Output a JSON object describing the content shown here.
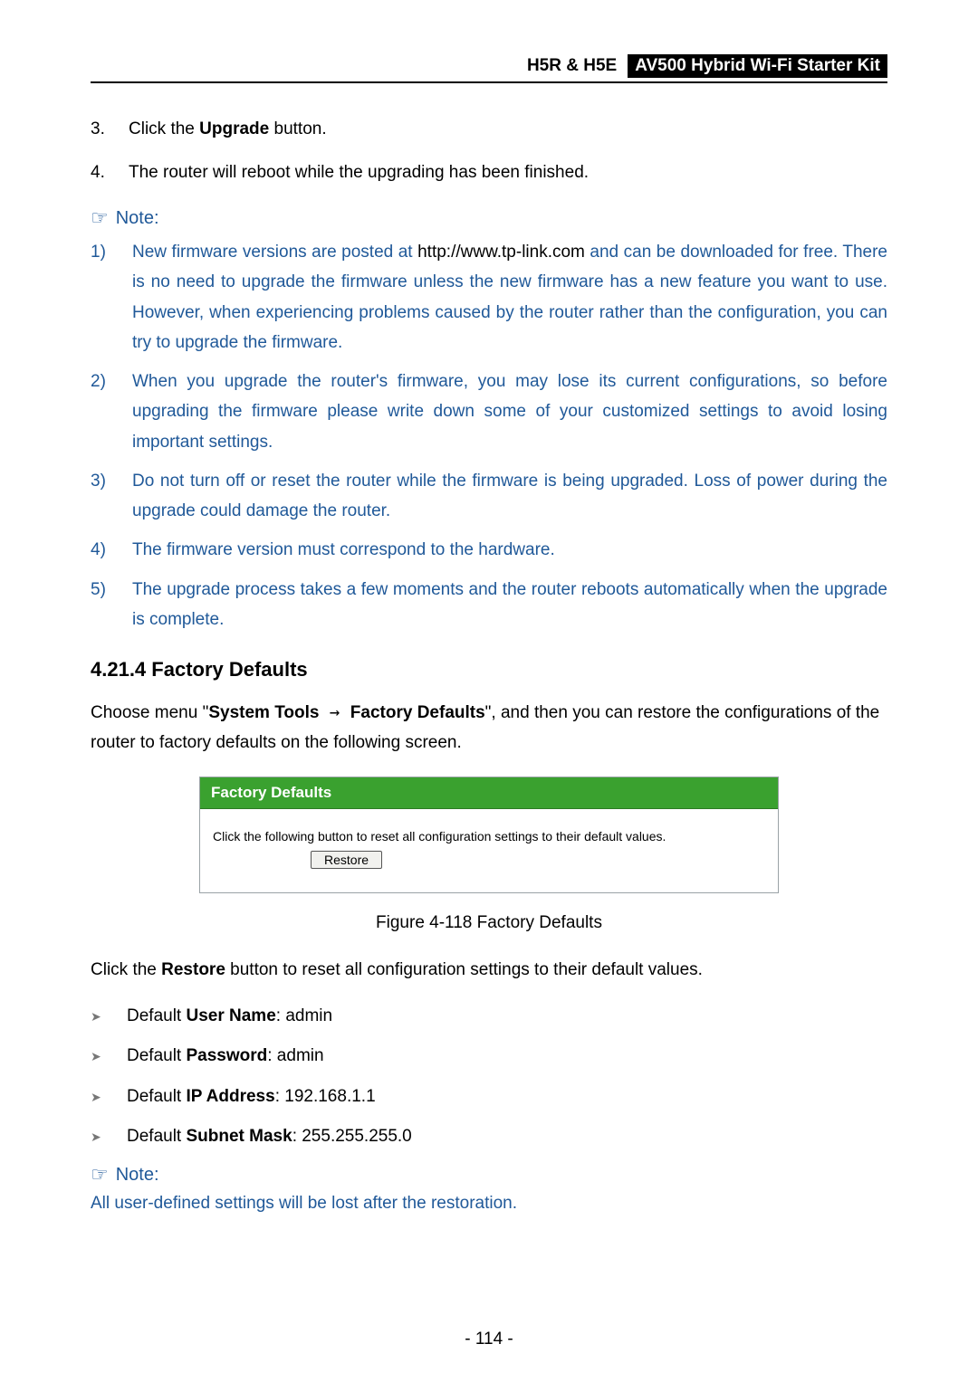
{
  "header": {
    "model": "H5R & H5E",
    "kit": "AV500 Hybrid Wi-Fi Starter Kit"
  },
  "steps": [
    {
      "n": "3.",
      "text_pre": "Click the ",
      "bold": "Upgrade",
      "text_post": " button."
    },
    {
      "n": "4.",
      "text_pre": "The router will reboot while the upgrading has been finished.",
      "bold": "",
      "text_post": ""
    }
  ],
  "note_label": "Note:",
  "notes1": [
    {
      "n": "1)",
      "pre": "New firmware versions are posted at ",
      "url": "http://www.tp-link.com",
      "post": " and can be downloaded for free. There is no need to upgrade the firmware unless the new firmware has a new feature you want to use. However, when experiencing problems caused by the router rather than the configuration, you can try to upgrade the firmware."
    },
    {
      "n": "2)",
      "pre": "",
      "url": "",
      "post": "When you upgrade the router's firmware, you may lose its current configurations, so before upgrading the firmware please write down some of your customized settings to avoid losing important settings."
    },
    {
      "n": "3)",
      "pre": "",
      "url": "",
      "post": "Do not turn off or reset the router while the firmware is being upgraded. Loss of power during the upgrade could damage the router."
    },
    {
      "n": "4)",
      "pre": "",
      "url": "",
      "post": "The firmware version must correspond to the hardware."
    },
    {
      "n": "5)",
      "pre": "",
      "url": "",
      "post": "The upgrade process takes a few moments and the router reboots automatically when the upgrade is complete."
    }
  ],
  "section_heading": "4.21.4  Factory Defaults",
  "choose_menu": {
    "pre": "Choose menu \"",
    "menu1": "System Tools",
    "arrow": "  →  ",
    "menu2": "Factory Defaults",
    "post": "\", and then you can restore the configurations of the router to factory defaults on the following screen."
  },
  "figure": {
    "title": "Factory Defaults",
    "body": "Click the following button to reset all configuration settings to their default values.",
    "button": "Restore",
    "caption": "Figure 4-118 Factory Defaults"
  },
  "restore_intro": {
    "pre": "Click the ",
    "bold": "Restore",
    "post": " button to reset all configuration settings to their default values."
  },
  "defaults": [
    {
      "pre": "Default ",
      "bold": "User Name",
      "post": ": admin"
    },
    {
      "pre": "Default ",
      "bold": "Password",
      "post": ": admin"
    },
    {
      "pre": "Default ",
      "bold": "IP Address",
      "post": ": 192.168.1.1"
    },
    {
      "pre": "Default ",
      "bold": "Subnet Mask",
      "post": ": 255.255.255.0"
    }
  ],
  "note2_text": "All user-defined settings will be lost after the restoration.",
  "page_number": "- 114 -"
}
